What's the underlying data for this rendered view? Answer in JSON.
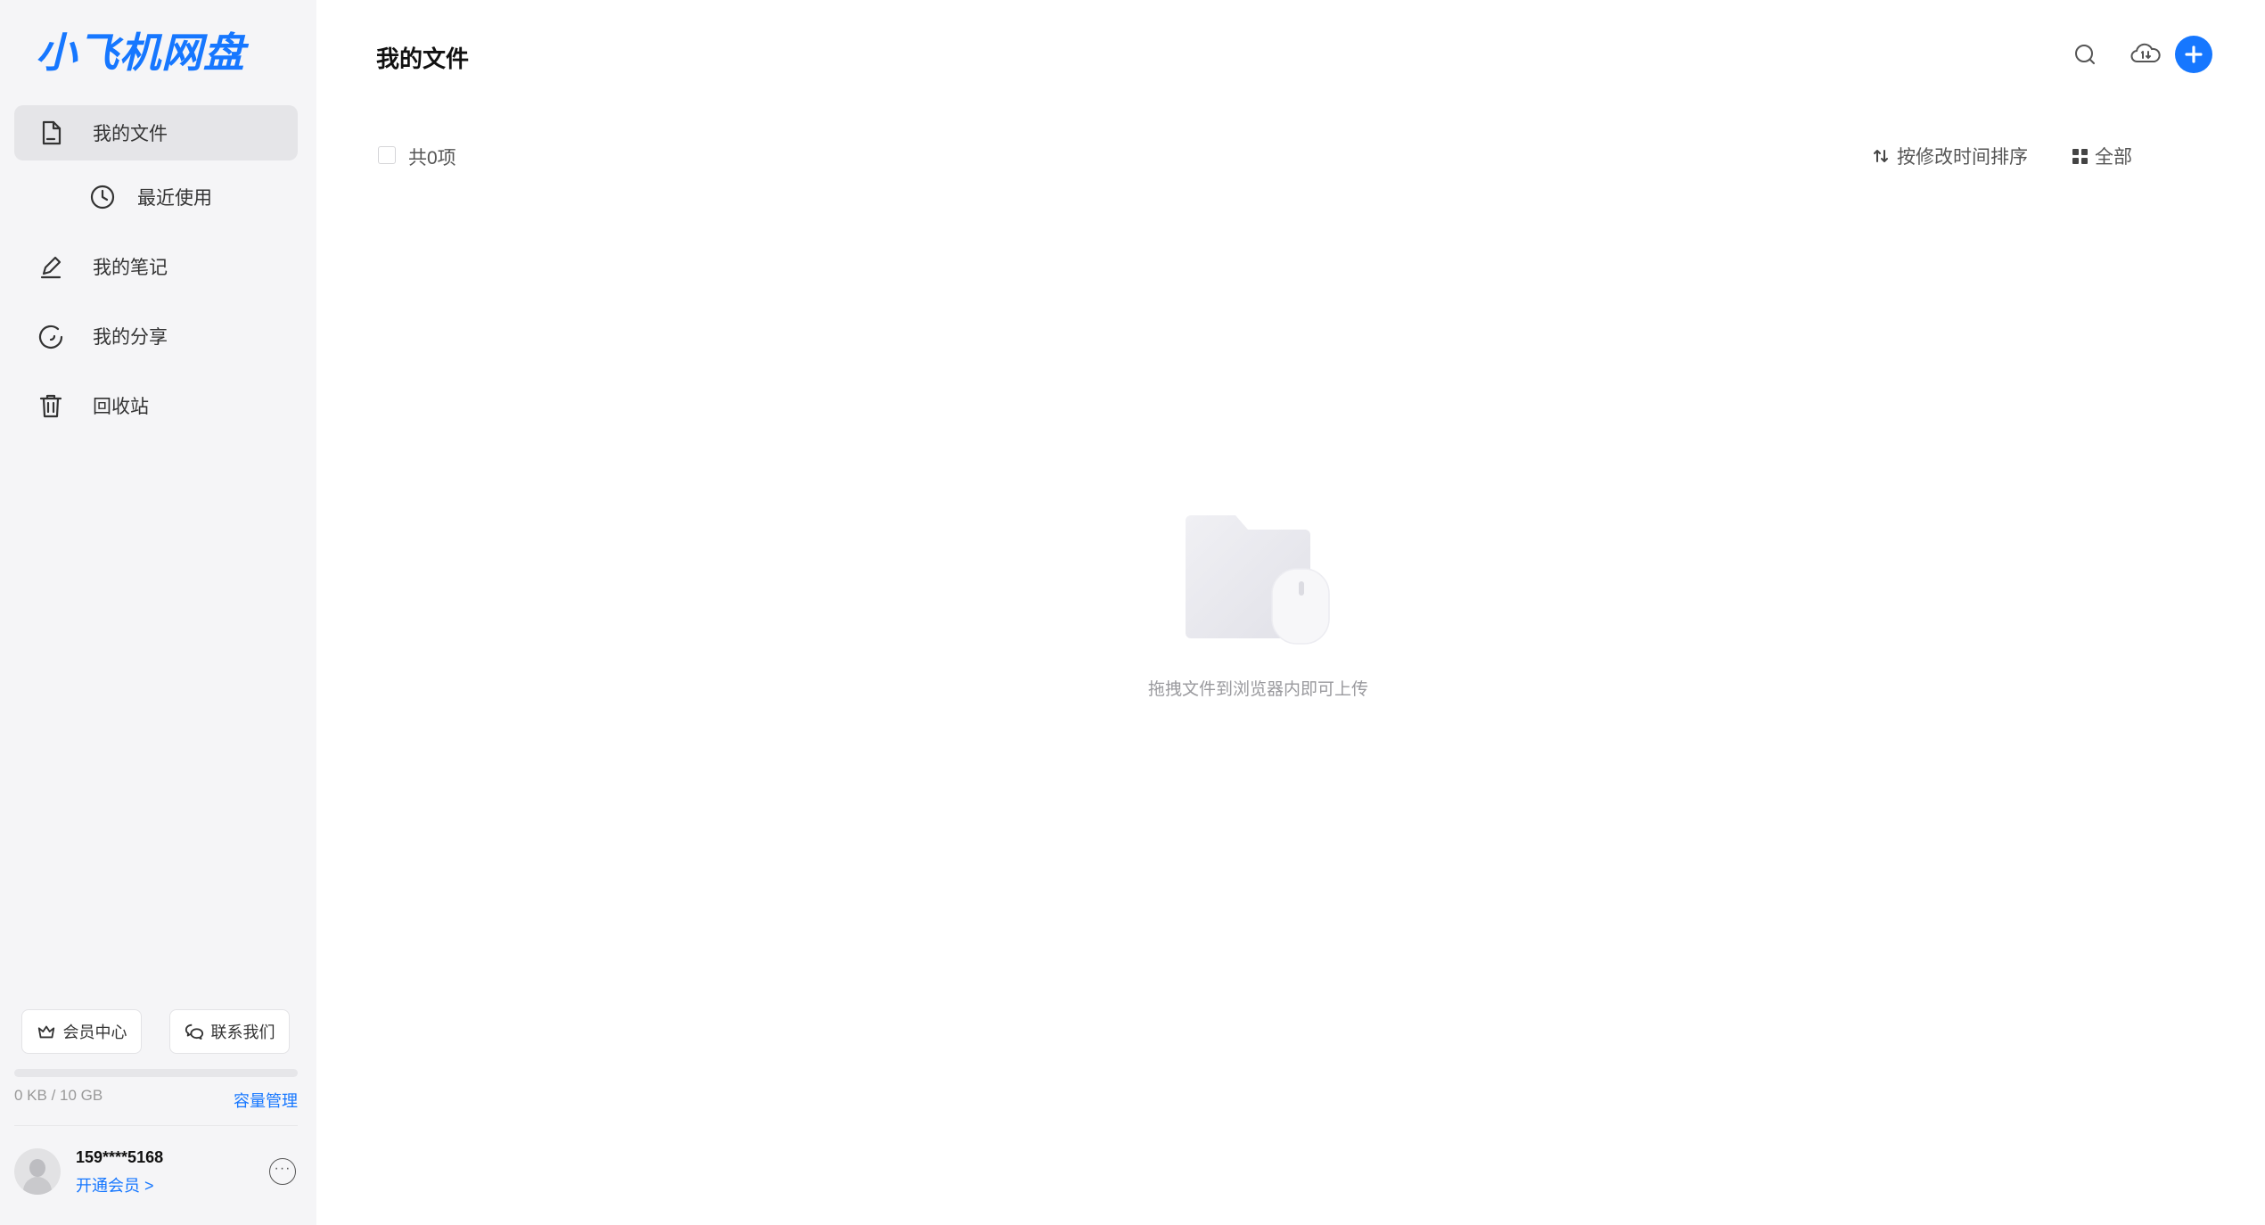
{
  "app": {
    "logo_text": "小飞机网盘"
  },
  "sidebar": {
    "items": [
      {
        "label": "我的文件",
        "icon": "file-icon",
        "active": true
      },
      {
        "label": "最近使用",
        "icon": "clock-icon",
        "active": false
      },
      {
        "label": "我的笔记",
        "icon": "pencil-icon",
        "active": false
      },
      {
        "label": "我的分享",
        "icon": "share-icon",
        "active": false
      },
      {
        "label": "回收站",
        "icon": "trash-icon",
        "active": false
      }
    ],
    "vip_center_label": "会员中心",
    "contact_label": "联系我们",
    "storage": {
      "used_text": "0 KB / 10 GB",
      "used_fraction": 0,
      "manage_label": "容量管理"
    },
    "user": {
      "phone": "159****5168",
      "vip_link": "开通会员 >"
    }
  },
  "main": {
    "title": "我的文件",
    "toolbar": {
      "search_icon": "search-icon",
      "cloud_icon": "cloud-sync-icon",
      "add_icon": "plus-icon"
    },
    "list_header": {
      "count_text": "共0项",
      "sort_label": "按修改时间排序",
      "view_label": "全部"
    },
    "empty_state": {
      "hint": "拖拽文件到浏览器内即可上传"
    }
  },
  "colors": {
    "accent": "#1677ff",
    "sidebar_bg": "#f5f5f7",
    "active_item_bg": "#e5e5e8"
  }
}
